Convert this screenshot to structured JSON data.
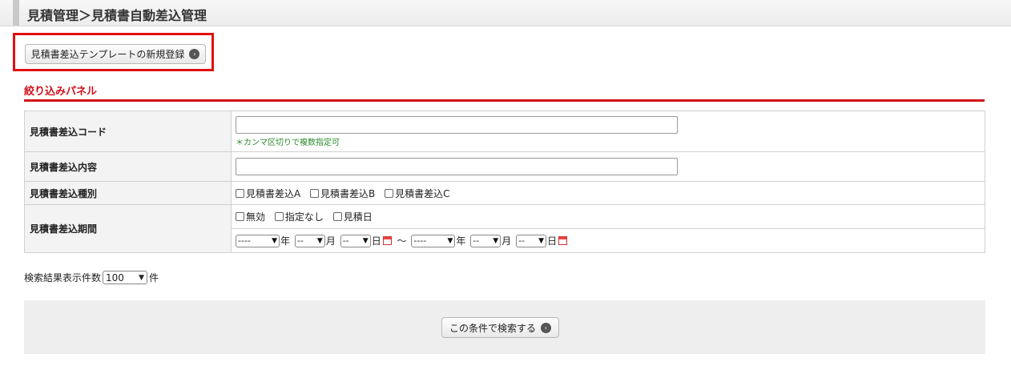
{
  "header": {
    "title": "見積管理＞見積書自動差込管理"
  },
  "actions": {
    "new_template_label": "見積書差込テンプレートの新規登録",
    "arrow": "›"
  },
  "filter_panel": {
    "title": "絞り込みパネル",
    "rows": {
      "code": {
        "label": "見積書差込コード",
        "value": "",
        "note": "＊カンマ区切りで複数指定可"
      },
      "content": {
        "label": "見積書差込内容",
        "value": ""
      },
      "type": {
        "label": "見積書差込種別",
        "options": [
          "見積書差込A",
          "見積書差込B",
          "見積書差込C"
        ]
      },
      "period": {
        "label": "見積書差込期間",
        "options": [
          "無効",
          "指定なし",
          "見積日"
        ],
        "year_placeholder": "----",
        "month_placeholder": "--",
        "day_placeholder": "--",
        "year_unit": "年",
        "month_unit": "月",
        "day_unit": "日",
        "range_separator": "～"
      }
    }
  },
  "results": {
    "label": "検索結果表示件数",
    "value": "100",
    "suffix": "件"
  },
  "search": {
    "button_label": "この条件で検索する"
  }
}
